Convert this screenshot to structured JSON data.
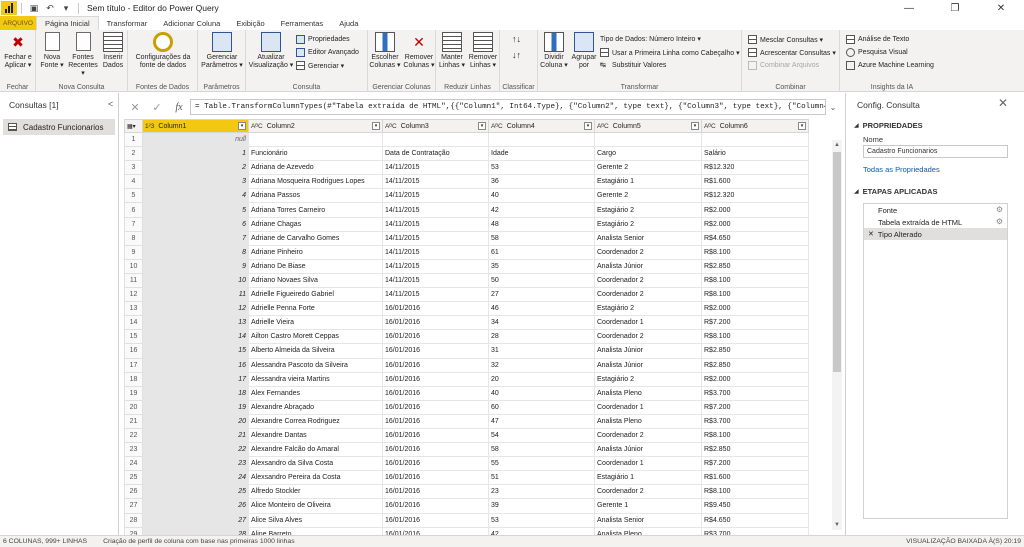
{
  "window": {
    "title": "Sem título - Editor do Power Query",
    "controls": [
      "—",
      "❐",
      "✕"
    ]
  },
  "ribbon_tabs": [
    {
      "label": "ARQUIVO"
    },
    {
      "label": "Página Inicial"
    },
    {
      "label": "Transformar"
    },
    {
      "label": "Adicionar Coluna"
    },
    {
      "label": "Exibição"
    },
    {
      "label": "Ferramentas"
    },
    {
      "label": "Ajuda"
    }
  ],
  "ribbon": {
    "fechar": {
      "label1": "Fechar e",
      "label2": "Aplicar ▾",
      "group": "Fechar"
    },
    "nova_fonte": {
      "label1": "Nova",
      "label2": "Fonte ▾"
    },
    "fontes_recentes": {
      "label1": "Fontes",
      "label2": "Recentes ▾"
    },
    "inserir_dados": {
      "label1": "Inserir",
      "label2": "Dados"
    },
    "nova_consulta_group": "Nova Consulta",
    "config_fonte": {
      "label1": "Configurações da",
      "label2": "fonte de dados",
      "group": "Fontes de Dados"
    },
    "gerenciar_param": {
      "label1": "Gerenciar",
      "label2": "Parâmetros ▾",
      "group": "Parâmetros"
    },
    "atualizar": {
      "label1": "Atualizar",
      "label2": "Visualização ▾"
    },
    "propriedades": "Propriedades",
    "editor_avancado": "Editor Avançado",
    "gerenciar": "Gerenciar ▾",
    "consulta_group": "Consulta",
    "escolher_colunas": {
      "label1": "Escolher",
      "label2": "Colunas ▾"
    },
    "remover_colunas": {
      "label1": "Remover",
      "label2": "Colunas ▾"
    },
    "gerenciar_colunas_group": "Gerenciar Colunas",
    "manter_linhas": {
      "label1": "Manter",
      "label2": "Linhas ▾"
    },
    "remover_linhas": {
      "label1": "Remover",
      "label2": "Linhas ▾"
    },
    "reduzir_linhas_group": "Reduzir Linhas",
    "classificar_group": "Classificar",
    "dividir_coluna": {
      "label1": "Dividir",
      "label2": "Coluna ▾"
    },
    "agrupar_por": {
      "label1": "Agrupar",
      "label2": "por"
    },
    "tipo_dados": "Tipo de Dados: Número Inteiro ▾",
    "primeira_linha": "Usar a Primeira Linha como Cabeçalho ▾",
    "substituir_valores": "Substituir Valores",
    "transformar_group": "Transformar",
    "mesclar": "Mesclar Consultas ▾",
    "acrescentar": "Acrescentar Consultas ▾",
    "combinar_arquivos": "Combinar Arquivos",
    "combinar_group": "Combinar",
    "analise_texto": "Análise de Texto",
    "pesquisa_visual": "Pesquisa Visual",
    "azure_ml": "Azure Machine Learning",
    "insights_group": "Insights da IA"
  },
  "queries_pane": {
    "title": "Consultas [1]",
    "collapse": "<",
    "items": [
      "Cadastro Funcionarios"
    ]
  },
  "formula_bar": {
    "cancel": "✕",
    "confirm": "✓",
    "fx": "fx",
    "text": "= Table.TransformColumnTypes(#\"Tabela extraída de HTML\",{{\"Column1\", Int64.Type}, {\"Column2\", type text}, {\"Column3\", type text}, {\"Column4\", "
  },
  "grid": {
    "columns": [
      {
        "type": "1²3",
        "name": "Column1"
      },
      {
        "type": "AᴮC",
        "name": "Column2"
      },
      {
        "type": "AᴮC",
        "name": "Column3"
      },
      {
        "type": "AᴮC",
        "name": "Column4"
      },
      {
        "type": "AᴮC",
        "name": "Column5"
      },
      {
        "type": "AᴮC",
        "name": "Column6"
      }
    ],
    "rows": [
      [
        "1",
        "null",
        "",
        "",
        "",
        "",
        ""
      ],
      [
        "2",
        "1",
        "Funcionário",
        "Data de Contratação",
        "Idade",
        "Cargo",
        "Salário"
      ],
      [
        "3",
        "2",
        "Adriana de Azevedo",
        "14/11/2015",
        "53",
        "Gerente 2",
        "R$12.320"
      ],
      [
        "4",
        "3",
        "Adriana Mosqueira Rodrigues Lopes",
        "14/11/2015",
        "36",
        "Estagiário 1",
        "R$1.600"
      ],
      [
        "5",
        "4",
        "Adriana Passos",
        "14/11/2015",
        "40",
        "Gerente 2",
        "R$12.320"
      ],
      [
        "6",
        "5",
        "Adriana Torres Carneiro",
        "14/11/2015",
        "42",
        "Estagiário 2",
        "R$2.000"
      ],
      [
        "7",
        "6",
        "Adriane Chagas",
        "14/11/2015",
        "48",
        "Estagiário 2",
        "R$2.000"
      ],
      [
        "8",
        "7",
        "Adriane de Carvalho Gomes",
        "14/11/2015",
        "58",
        "Analista Senior",
        "R$4.650"
      ],
      [
        "9",
        "8",
        "Adriane Pinheiro",
        "14/11/2015",
        "61",
        "Coordenador 2",
        "R$8.100"
      ],
      [
        "10",
        "9",
        "Adriano De Biase",
        "14/11/2015",
        "35",
        "Analista Júnior",
        "R$2.850"
      ],
      [
        "11",
        "10",
        "Adriano Novaes Silva",
        "14/11/2015",
        "50",
        "Coordenador 2",
        "R$8.100"
      ],
      [
        "12",
        "11",
        "Adrielle Figueiredo Gabriel",
        "14/11/2015",
        "27",
        "Coordenador 2",
        "R$8.100"
      ],
      [
        "13",
        "12",
        "Adrielle Penna Forte",
        "16/01/2016",
        "46",
        "Estagiário 2",
        "R$2.000"
      ],
      [
        "14",
        "13",
        "Adrielle Vieira",
        "16/01/2016",
        "34",
        "Coordenador 1",
        "R$7.200"
      ],
      [
        "15",
        "14",
        "Ailton Castro Morett Ceppas",
        "16/01/2016",
        "28",
        "Coordenador 2",
        "R$8.100"
      ],
      [
        "16",
        "15",
        "Alberto Almeida da Silveira",
        "16/01/2016",
        "31",
        "Analista Júnior",
        "R$2.850"
      ],
      [
        "17",
        "16",
        "Alessandra Pascoto da Silveira",
        "16/01/2016",
        "32",
        "Analista Júnior",
        "R$2.850"
      ],
      [
        "18",
        "17",
        "Alessandra vieira Martins",
        "16/01/2016",
        "20",
        "Estagiário 2",
        "R$2.000"
      ],
      [
        "19",
        "18",
        "Alex Fernandes",
        "16/01/2016",
        "40",
        "Analista Pleno",
        "R$3.700"
      ],
      [
        "20",
        "19",
        "Alexandre Abraçado",
        "16/01/2016",
        "60",
        "Coordenador 1",
        "R$7.200"
      ],
      [
        "21",
        "20",
        "Alexandre Correa Rodriguez",
        "16/01/2016",
        "47",
        "Analista Pleno",
        "R$3.700"
      ],
      [
        "22",
        "21",
        "Alexandre Dantas",
        "16/01/2016",
        "54",
        "Coordenador 2",
        "R$8.100"
      ],
      [
        "23",
        "22",
        "Alexandre Falcão do Amaral",
        "16/01/2016",
        "58",
        "Analista Júnior",
        "R$2.850"
      ],
      [
        "24",
        "23",
        "Alexsandro da Silva Costa",
        "16/01/2016",
        "55",
        "Coordenador 1",
        "R$7.200"
      ],
      [
        "25",
        "24",
        "Alexsandro Pereira da Costa",
        "16/01/2016",
        "51",
        "Estagiário 1",
        "R$1.600"
      ],
      [
        "26",
        "25",
        "Alfredo Stockler",
        "16/01/2016",
        "23",
        "Coordenador 2",
        "R$8.100"
      ],
      [
        "27",
        "26",
        "Alice Monteiro de Oliveira",
        "16/01/2016",
        "39",
        "Gerente 1",
        "R$9.450"
      ],
      [
        "28",
        "27",
        "Alice Silva Alves",
        "16/01/2016",
        "53",
        "Analista Senior",
        "R$4.650"
      ],
      [
        "29",
        "28",
        "Aline Barreto",
        "16/01/2016",
        "42",
        "Analista Pleno",
        "R$3.700"
      ]
    ]
  },
  "settings_pane": {
    "title": "Config. Consulta",
    "close": "✕",
    "properties_header": "PROPRIEDADES",
    "name_label": "Nome",
    "name_value": "Cadastro Funcionarios",
    "all_properties_link": "Todas as Propriedades",
    "steps_header": "ETAPAS APLICADAS",
    "steps": [
      {
        "label": "Fonte",
        "gear": true
      },
      {
        "label": "Tabela extraída de HTML",
        "gear": true
      },
      {
        "label": "Tipo Alterado",
        "gear": false
      }
    ]
  },
  "status_bar": {
    "columns_rows": "6 COLUNAS, 999+ LINHAS",
    "profiling": "Criação de perfil de coluna com base nas primeiras 1000 linhas",
    "preview": "VISUALIZAÇÃO BAIXADA À(S) 20:19"
  }
}
